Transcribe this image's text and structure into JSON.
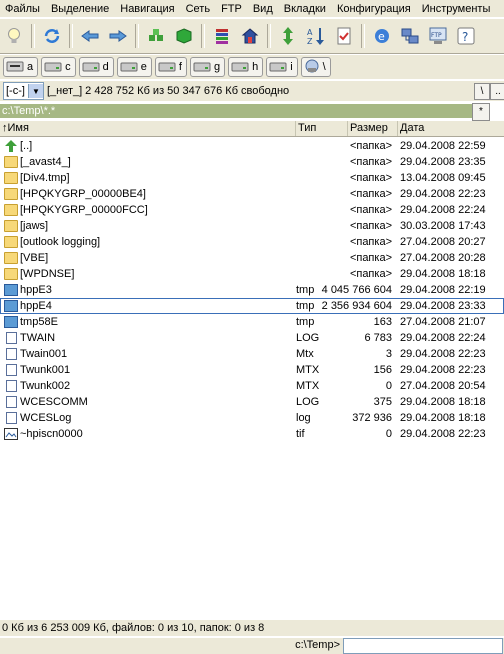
{
  "menu": [
    "Файлы",
    "Выделение",
    "Навигация",
    "Сеть",
    "FTP",
    "Вид",
    "Вкладки",
    "Конфигурация",
    "Инструменты"
  ],
  "drives": [
    {
      "letter": "a",
      "icon": "floppy-drive-icon"
    },
    {
      "letter": "c",
      "icon": "hard-drive-icon"
    },
    {
      "letter": "d",
      "icon": "hard-drive-icon"
    },
    {
      "letter": "e",
      "icon": "hard-drive-icon"
    },
    {
      "letter": "f",
      "icon": "hard-drive-icon"
    },
    {
      "letter": "g",
      "icon": "hard-drive-icon"
    },
    {
      "letter": "h",
      "icon": "hard-drive-icon"
    },
    {
      "letter": "i",
      "icon": "hard-drive-icon"
    },
    {
      "letter": "\\",
      "icon": "network-drive-icon"
    }
  ],
  "drive_combo": {
    "value": "[-c-]",
    "label": "[_нет_]"
  },
  "free_space": "2 428 752 Кб из 50 347 676 Кб свободно",
  "root_btn": "\\",
  "up_btn": "..",
  "current_path": "c:\\Temp\\*.*",
  "filter_btn": "*",
  "columns": {
    "name": "↑Имя",
    "ext": "Тип",
    "size": "Размер",
    "date": "Дата"
  },
  "files": [
    {
      "name": "[..]",
      "ext": "",
      "size": "<папка>",
      "date": "29.04.2008 22:59",
      "kind": "up"
    },
    {
      "name": "[_avast4_]",
      "ext": "",
      "size": "<папка>",
      "date": "29.04.2008 23:35",
      "kind": "folder"
    },
    {
      "name": "[Div4.tmp]",
      "ext": "",
      "size": "<папка>",
      "date": "13.04.2008 09:45",
      "kind": "folder"
    },
    {
      "name": "[HPQKYGRP_00000BE4]",
      "ext": "",
      "size": "<папка>",
      "date": "29.04.2008 22:23",
      "kind": "folder"
    },
    {
      "name": "[HPQKYGRP_00000FCC]",
      "ext": "",
      "size": "<папка>",
      "date": "29.04.2008 22:24",
      "kind": "folder"
    },
    {
      "name": "[jaws]",
      "ext": "",
      "size": "<папка>",
      "date": "30.03.2008 17:43",
      "kind": "folder"
    },
    {
      "name": "[outlook logging]",
      "ext": "",
      "size": "<папка>",
      "date": "27.04.2008 20:27",
      "kind": "folder"
    },
    {
      "name": "[VBE]",
      "ext": "",
      "size": "<папка>",
      "date": "27.04.2008 20:28",
      "kind": "folder"
    },
    {
      "name": "[WPDNSE]",
      "ext": "",
      "size": "<папка>",
      "date": "29.04.2008 18:18",
      "kind": "folder"
    },
    {
      "name": "hppE3",
      "ext": "tmp",
      "size": "4 045 766 604",
      "date": "29.04.2008 22:19",
      "kind": "tmp"
    },
    {
      "name": "hppE4",
      "ext": "tmp",
      "size": "2 356 934 604",
      "date": "29.04.2008 23:33",
      "kind": "tmp"
    },
    {
      "name": "tmp58E",
      "ext": "tmp",
      "size": "163",
      "date": "27.04.2008 21:07",
      "kind": "tmp"
    },
    {
      "name": "TWAIN",
      "ext": "LOG",
      "size": "6 783",
      "date": "29.04.2008 22:24",
      "kind": "file"
    },
    {
      "name": "Twain001",
      "ext": "Mtx",
      "size": "3",
      "date": "29.04.2008 22:23",
      "kind": "file"
    },
    {
      "name": "Twunk001",
      "ext": "MTX",
      "size": "156",
      "date": "29.04.2008 22:23",
      "kind": "file"
    },
    {
      "name": "Twunk002",
      "ext": "MTX",
      "size": "0",
      "date": "27.04.2008 20:54",
      "kind": "file"
    },
    {
      "name": "WCESCOMM",
      "ext": "LOG",
      "size": "375",
      "date": "29.04.2008 18:18",
      "kind": "file"
    },
    {
      "name": "WCESLog",
      "ext": "log",
      "size": "372 936",
      "date": "29.04.2008 18:18",
      "kind": "file"
    },
    {
      "name": "~hpiscn0000",
      "ext": "tif",
      "size": "0",
      "date": "29.04.2008 22:23",
      "kind": "image"
    }
  ],
  "focused_row": "hppE4",
  "status": "0 Кб из 6 253 009 Кб, файлов: 0 из 10, папок: 0 из 8",
  "cmd_label": "c:\\Temp>",
  "cmd_value": ""
}
